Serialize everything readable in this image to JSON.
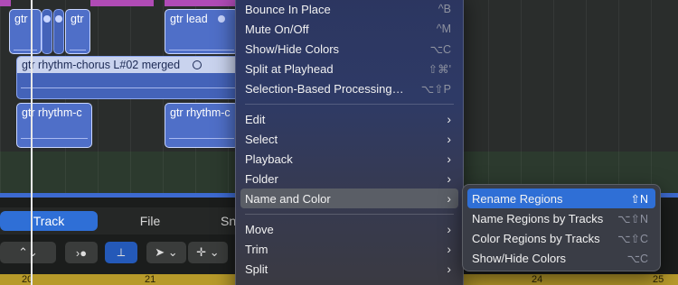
{
  "regions": {
    "top": [
      "gtr",
      "gtr",
      "gtr lead"
    ],
    "merged": "gtr rhythm-chorus L#02 merged",
    "lower": [
      "gtr rhythm-c",
      "gtr rhythm-c"
    ]
  },
  "tabs": [
    "Track",
    "File",
    "Sn"
  ],
  "ruler": [
    "20",
    "21",
    "24",
    "25"
  ],
  "menu": {
    "items": [
      {
        "label": "Bounce In Place",
        "shortcut": "^B"
      },
      {
        "label": "Mute On/Off",
        "shortcut": "^M"
      },
      {
        "label": "Show/Hide Colors",
        "shortcut": "⌥C"
      },
      {
        "label": "Split at Playhead",
        "shortcut": "⇧⌘'"
      },
      {
        "label": "Selection-Based Processing…",
        "shortcut": "⌥⇧P"
      }
    ],
    "groups": [
      "Edit",
      "Select",
      "Playback",
      "Folder",
      "Name and Color"
    ],
    "groups2": [
      "Move",
      "Trim",
      "Split"
    ]
  },
  "submenu": {
    "items": [
      {
        "label": "Rename Regions",
        "shortcut": "⇧N"
      },
      {
        "label": "Name Regions by Tracks",
        "shortcut": "⌥⇧N"
      },
      {
        "label": "Color Regions by Tracks",
        "shortcut": "⌥⇧C"
      },
      {
        "label": "Show/Hide Colors",
        "shortcut": "⌥C"
      }
    ]
  },
  "colors": {
    "accent": "#2f6fd6",
    "region": "#4463b9",
    "ruler": "#b79a2a"
  }
}
